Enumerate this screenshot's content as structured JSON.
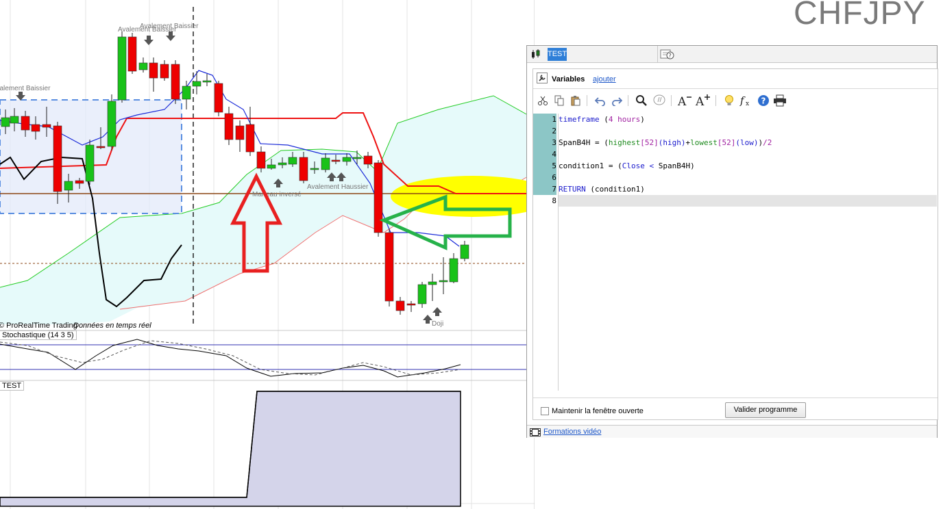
{
  "symbol": "CHFJPY",
  "chart": {
    "copyright": "© ProRealTime Trading",
    "realtime": "Données en temps réel",
    "patterns": {
      "p1": "Avalement Baissier",
      "p2": "Avalement Baissier",
      "p3": "Avalement Baissier",
      "p4": "Marteau inversé",
      "p5": "Avalement Haussier",
      "p6": "Doji"
    },
    "stochastic_label": "Stochastique (14 3 5)",
    "test_label": "TEST"
  },
  "colors": {
    "bull": "#19c219",
    "bear": "#ee0000",
    "cloud": "#e6fafa",
    "accent_tab": "#2f7fd8",
    "highlight": "#ffff00",
    "arrow_red": "#e82020",
    "arrow_green": "#26b24a"
  },
  "editor": {
    "tab_name": "TEST",
    "variables_title": "Variables",
    "add_link": "ajouter",
    "toolbar_icons": [
      "cut-icon",
      "copy-icon",
      "paste-icon",
      "undo-icon",
      "redo-icon",
      "search-icon",
      "comment-icon",
      "font-decrease-icon",
      "font-increase-icon",
      "lightbulb-icon",
      "function-icon",
      "help-icon",
      "print-icon"
    ],
    "code_lines": [
      {
        "n": "1",
        "tokens": [
          {
            "t": "timeframe",
            "c": "kw"
          },
          {
            "t": " ("
          },
          {
            "t": "4 hours",
            "c": "num"
          },
          {
            "t": ")"
          }
        ]
      },
      {
        "n": "2",
        "tokens": []
      },
      {
        "n": "3",
        "tokens": [
          {
            "t": "SpanB4H = ("
          },
          {
            "t": "highest",
            "c": "fn"
          },
          {
            "t": "[52]",
            "c": "num"
          },
          {
            "t": "(high)",
            "c": "kw"
          },
          {
            "t": "+"
          },
          {
            "t": "lowest",
            "c": "fn"
          },
          {
            "t": "[52]",
            "c": "num"
          },
          {
            "t": "(low)",
            "c": "kw"
          },
          {
            "t": ")"
          },
          {
            "t": "/2",
            "c": "num"
          }
        ]
      },
      {
        "n": "4",
        "tokens": []
      },
      {
        "n": "5",
        "tokens": [
          {
            "t": "condition1 = ("
          },
          {
            "t": "Close",
            "c": "kw"
          },
          {
            "t": " < ",
            "c": "op"
          },
          {
            "t": "SpanB4H)"
          }
        ]
      },
      {
        "n": "6",
        "tokens": []
      },
      {
        "n": "7",
        "tokens": [
          {
            "t": "RETURN",
            "c": "kw"
          },
          {
            "t": " (condition1)"
          }
        ]
      },
      {
        "n": "8",
        "tokens": []
      }
    ],
    "keep_open_label": "Maintenir la fenêtre ouverte",
    "validate_label": "Valider programme",
    "video_link": "Formations vidéo"
  }
}
